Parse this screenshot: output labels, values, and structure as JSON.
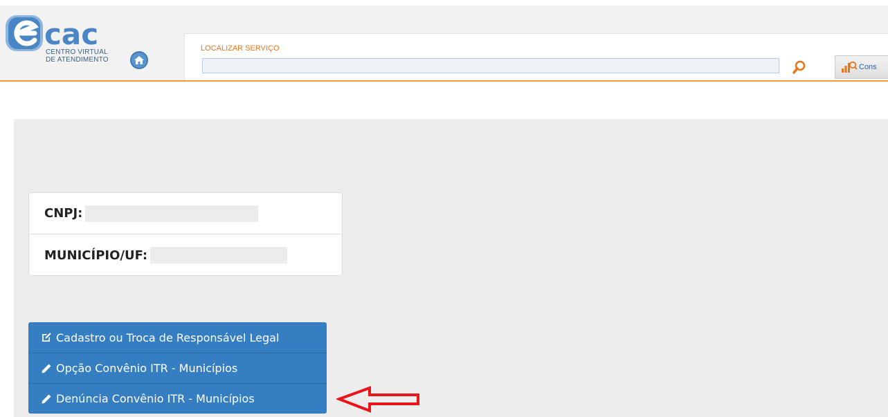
{
  "header": {
    "logo_text": "cac",
    "logo_sub_line1": "CENTRO VIRTUAL",
    "logo_sub_line2": "DE ATENDIMENTO",
    "search_label": "LOCALIZAR SERVIÇO",
    "search_value": "",
    "cons_button_label": "Cons"
  },
  "info": {
    "cnpj_label": "CNPJ:",
    "municipio_label": "MUNICÍPIO/UF:"
  },
  "menu": {
    "items": [
      {
        "label": "Cadastro ou Troca de Responsável Legal",
        "icon": "edit-square-icon"
      },
      {
        "label": "Opção Convênio ITR - Municípios",
        "icon": "pencil-icon"
      },
      {
        "label": "Denúncia Convênio ITR - Municípios",
        "icon": "pencil-icon"
      }
    ]
  },
  "colors": {
    "accent_orange": "#f39a3b",
    "menu_blue": "#357ec1",
    "arrow_red": "#e8161b"
  }
}
